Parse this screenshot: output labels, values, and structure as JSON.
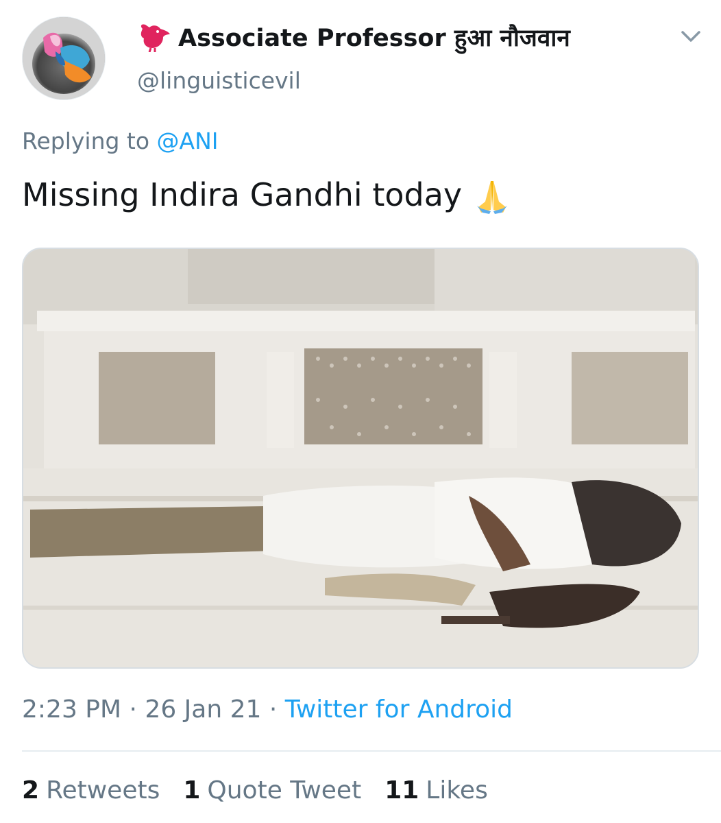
{
  "tweet": {
    "display_name": "Associate Professor हुआ नौजवान",
    "handle": "@linguisticevil",
    "reply_prefix": "Replying to",
    "reply_mention": "@ANI",
    "text": "Missing Indira Gandhi today",
    "emoji_name": "folded-hands-emoji",
    "time": "2:23 PM",
    "separator1": "·",
    "date": "26 Jan 21",
    "separator2": "·",
    "source": "Twitter for Android"
  },
  "stats": {
    "retweets_count": "2",
    "retweets_label": "Retweets",
    "quotes_count": "1",
    "quotes_label": "Quote Tweet",
    "likes_count": "11",
    "likes_label": "Likes"
  },
  "colors": {
    "text_primary": "#14171a",
    "text_secondary": "#657786",
    "link": "#1da1f2",
    "divider": "#e6ecf0",
    "bird_icon": "#e0245e"
  },
  "icons": {
    "name_prefix": "bird-icon",
    "more": "chevron-down-icon"
  }
}
